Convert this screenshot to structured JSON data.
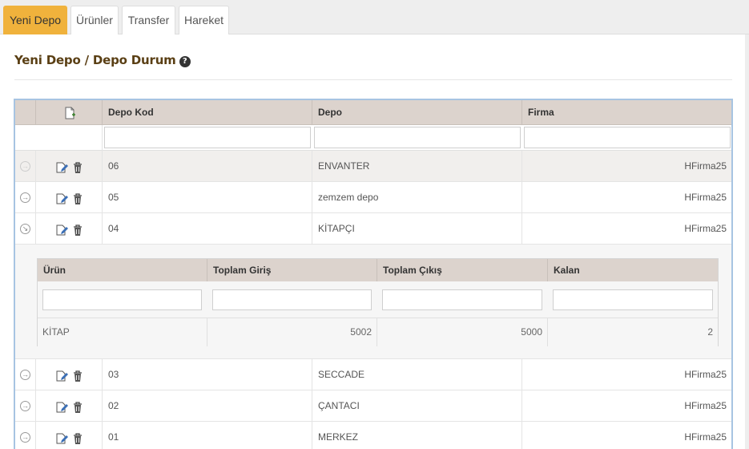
{
  "tabs": [
    {
      "label": "Yeni Depo",
      "active": true
    },
    {
      "label": "Ürünler",
      "active": false
    },
    {
      "label": "Transfer",
      "active": false
    },
    {
      "label": "Hareket",
      "active": false
    }
  ],
  "page": {
    "title": "Yeni Depo / Depo Durum",
    "help_icon": "question-circle-icon"
  },
  "grid": {
    "columns": [
      "Depo Kod",
      "Depo",
      "Firma"
    ],
    "add_icon": "new-document-icon",
    "rows": [
      {
        "kod": "06",
        "depo": "ENVANTER",
        "firma": "HFirma25"
      },
      {
        "kod": "05",
        "depo": "zemzem depo",
        "firma": "HFirma25"
      },
      {
        "kod": "04",
        "depo": "KİTAPÇI",
        "firma": "HFirma25"
      },
      {
        "kod": "03",
        "depo": "SECCADE",
        "firma": "HFirma25"
      },
      {
        "kod": "02",
        "depo": "ÇANTACI",
        "firma": "HFirma25"
      },
      {
        "kod": "01",
        "depo": "MERKEZ",
        "firma": "HFirma25"
      }
    ]
  },
  "detail": {
    "columns": [
      "Ürün",
      "Toplam Giriş",
      "Toplam Çıkış",
      "Kalan"
    ],
    "rows": [
      {
        "urun": "KİTAP",
        "giris": "5002",
        "cikis": "5000",
        "kalan": "2"
      }
    ]
  },
  "colors": {
    "active_tab": "#f0b23c",
    "header_bg": "#dcd3cd",
    "grid_border": "#a7c4e2",
    "title": "#5a3f14"
  }
}
